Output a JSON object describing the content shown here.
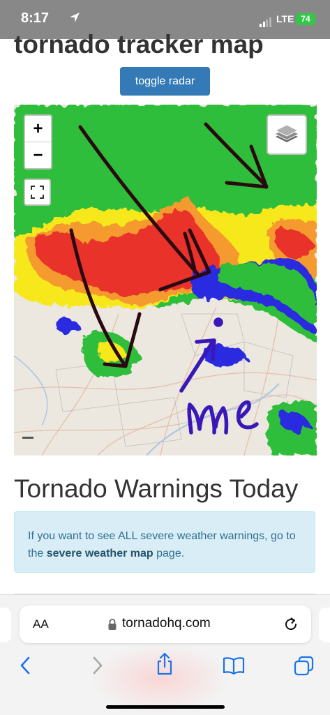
{
  "status_bar": {
    "time": "8:17",
    "network": "LTE",
    "battery": "74"
  },
  "page": {
    "title_partial": "tornado tracker map",
    "toggle_button": "toggle radar",
    "warnings_heading": "Tornado Warnings Today",
    "alert": {
      "text_before": "If you want to see ALL severe weather warnings, go to the ",
      "link_text": "severe weather map",
      "text_after": " page."
    }
  },
  "map": {
    "zoom_in": "+",
    "zoom_out": "−",
    "annotation_label": "me",
    "colors": {
      "land": "#ece7df",
      "radar_green": "#2fbe3a",
      "radar_yellow": "#f7e81f",
      "radar_orange": "#f59a2e",
      "radar_red": "#e8322a",
      "radar_blue": "#2b2be0",
      "pen_dark": "#2a0a10",
      "pen_blue": "#3a18b8"
    }
  },
  "browser": {
    "text_size_label": "AA",
    "url": "tornadohq.com",
    "accent": "#1a73e8"
  }
}
